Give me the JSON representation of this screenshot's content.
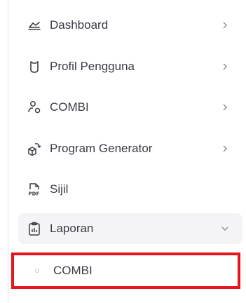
{
  "menu": {
    "items": [
      {
        "label": "Dashboard",
        "icon": "dashboard-icon",
        "has_chevron": true
      },
      {
        "label": "Profil Pengguna",
        "icon": "profile-icon",
        "has_chevron": true
      },
      {
        "label": "COMBI",
        "icon": "user-settings-icon",
        "has_chevron": true
      },
      {
        "label": "Program Generator",
        "icon": "generator-icon",
        "has_chevron": true
      },
      {
        "label": "Sijil",
        "icon": "pdf-file-icon",
        "has_chevron": false
      },
      {
        "label": "Laporan",
        "icon": "report-icon",
        "has_chevron": true,
        "expanded": true
      }
    ],
    "submenu": [
      {
        "label": "COMBI",
        "highlighted": true
      }
    ]
  },
  "colors": {
    "highlight_border": "#e8141d",
    "active_bg": "#f4f4f6",
    "text": "#3b3b46"
  }
}
